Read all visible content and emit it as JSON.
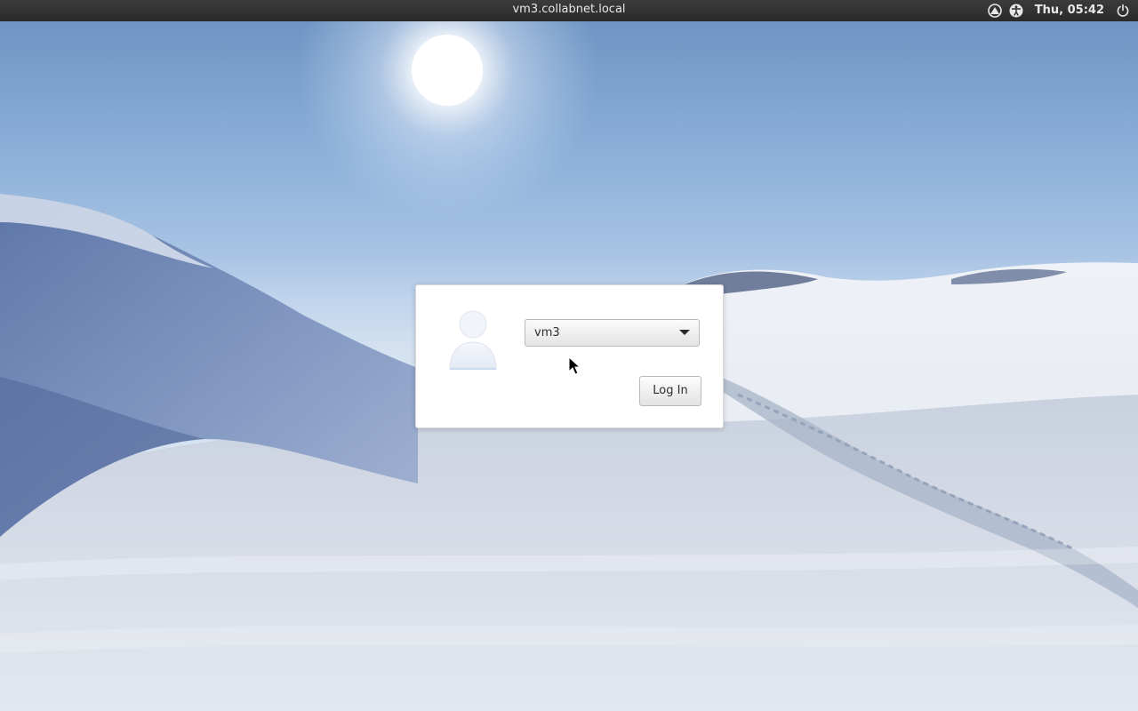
{
  "topbar": {
    "hostname": "vm3.collabnet.local",
    "clock": "Thu, 05:42",
    "icons": [
      "network-icon",
      "accessibility-icon",
      "power-icon"
    ]
  },
  "login": {
    "selected_user": "vm3",
    "login_label": "Log In"
  },
  "colors": {
    "topbar_bg": "#2e2e2e",
    "sky_top": "#6f95c4",
    "dialog_bg": "#ffffff"
  }
}
